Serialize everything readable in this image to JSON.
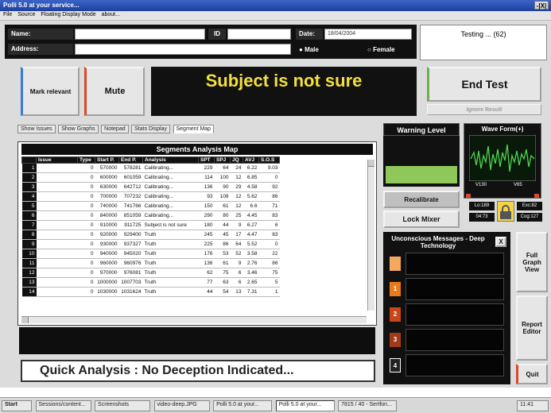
{
  "window": {
    "title": "Polli 5.0 at your service...",
    "control": "-|X|"
  },
  "menu": [
    "File",
    "Source",
    "Floating Display Mode",
    "about..."
  ],
  "form": {
    "name_label": "Name:",
    "id_label": "ID",
    "address_label": "Address:",
    "date_label": "Date:",
    "date_value": "18/04/2004",
    "male": "Male",
    "female": "Female",
    "gender_selected": "male"
  },
  "testing": "Testing ... (62)",
  "buttons": {
    "mark_relevant": "Mark relevant",
    "mute": "Mute",
    "end_test": "End Test",
    "ignore_result": "Ignore Result",
    "recalibrate": "Recalibrate",
    "lock_mixer": "Lock Mixer",
    "full_graph_view": "Full Graph View",
    "report_editor": "Report Editor",
    "quit": "Quit",
    "close_x": "X"
  },
  "status": "Subject is not sure",
  "tabs": [
    "Show Issues",
    "Show Graphs",
    "Notepad",
    "Stats Display",
    "Segment Map"
  ],
  "active_tab": 4,
  "map": {
    "title": "Segments Analysis Map",
    "columns": [
      "Issue",
      "Type",
      "Start P.",
      "End P.",
      "Analysis",
      "SPT",
      "SPJ",
      "JQ",
      "AVJ",
      "S.O.S"
    ],
    "rows": [
      [
        "1",
        "",
        "0",
        "570000",
        "578281",
        "Calibrating...",
        "229",
        "64",
        "24",
        "6.22",
        "9.03"
      ],
      [
        "2",
        "",
        "0",
        "600000",
        "601059",
        "Calibrating...",
        "114",
        "100",
        "12",
        "6.85",
        "0"
      ],
      [
        "3",
        "",
        "0",
        "630000",
        "642712",
        "Calibrating...",
        "136",
        "90",
        "29",
        "4.58",
        "92"
      ],
      [
        "4",
        "",
        "0",
        "700000",
        "707232",
        "Calibrating...",
        "93",
        "108",
        "12",
        "5.62",
        "86"
      ],
      [
        "5",
        "",
        "0",
        "740000",
        "741766",
        "Calibrating...",
        "150",
        "61",
        "12",
        "6.6",
        "71"
      ],
      [
        "6",
        "",
        "0",
        "840000",
        "851059",
        "Calibrating...",
        "290",
        "80",
        "25",
        "4.45",
        "83"
      ],
      [
        "7",
        "",
        "0",
        "910000",
        "911725",
        "Subject is not sure",
        "180",
        "44",
        "9",
        "6.27",
        "6"
      ],
      [
        "8",
        "",
        "0",
        "920000",
        "929400",
        "Truth",
        "245",
        "45",
        "17",
        "4.47",
        "83"
      ],
      [
        "9",
        "",
        "0",
        "930000",
        "937327",
        "Truth",
        "225",
        "86",
        "64",
        "5.52",
        "0"
      ],
      [
        "10",
        "",
        "0",
        "940000",
        "945020",
        "Truth",
        "176",
        "53",
        "52",
        "3.58",
        "22"
      ],
      [
        "11",
        "",
        "0",
        "960000",
        "960976",
        "Truth",
        "136",
        "61",
        "9",
        "2.76",
        "86"
      ],
      [
        "12",
        "",
        "0",
        "970000",
        "976081",
        "Truth",
        "62",
        "75",
        "6",
        "3.46",
        "75"
      ],
      [
        "13",
        "",
        "0",
        "1000000",
        "1007703",
        "Truth",
        "77",
        "63",
        "6",
        "2.65",
        "5"
      ],
      [
        "14",
        "",
        "0",
        "1030000",
        "1031624",
        "Truth",
        "44",
        "54",
        "13",
        "7.31",
        "1"
      ]
    ]
  },
  "quick_analysis": "Quick Analysis : No Deception Indicated...",
  "warning": {
    "title": "Warning Level",
    "level": 0.32
  },
  "wave": {
    "title": "Wave Form(+)",
    "left_readout": "V130",
    "right_readout": "V65",
    "stats": [
      "Lo:189",
      "Exc:82",
      "04:73",
      "Cog:127"
    ]
  },
  "unconscious": {
    "title": "Unconscious Messages - Deep Technology",
    "slots": [
      "",
      "1",
      "2",
      "3",
      "4"
    ],
    "colors": [
      "#f4a860",
      "#ec7a1a",
      "#c8461a",
      "#a23a1a",
      "#222222"
    ]
  },
  "taskbar": [
    "Start",
    "Sessions/content...",
    "Screenshots",
    "video-deep.JPG",
    "Polli 5.0 at your...",
    "Polli 5.0 at your...",
    "7815 / 40 - Sertfon...",
    "11:41"
  ]
}
